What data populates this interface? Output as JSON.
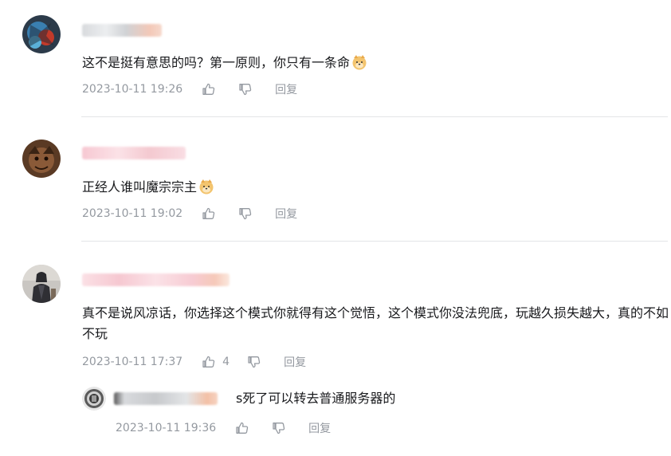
{
  "comments": [
    {
      "text": "这不是挺有意思的吗？第一原则，你只有一条命",
      "emoji": "doge-emoji",
      "time": "2023-10-11 19:26",
      "like_count": "",
      "reply_label": "回复"
    },
    {
      "text": "正经人谁叫魔宗宗主",
      "emoji": "doge-emoji",
      "time": "2023-10-11 19:02",
      "like_count": "",
      "reply_label": "回复"
    },
    {
      "text": "真不是说风凉话，你选择这个模式你就得有这个觉悟，这个模式你没法兜底，玩越久损失越大，真的不如不玩",
      "time": "2023-10-11 17:37",
      "like_count": "4",
      "reply_label": "回复",
      "sub_reply": {
        "text": "s死了可以转去普通服务器的",
        "time": "2023-10-11 19:36",
        "reply_label": "回复"
      }
    }
  ],
  "colors": {
    "text": "#18191c",
    "meta": "#9499a0",
    "divider": "#e3e5e7"
  }
}
